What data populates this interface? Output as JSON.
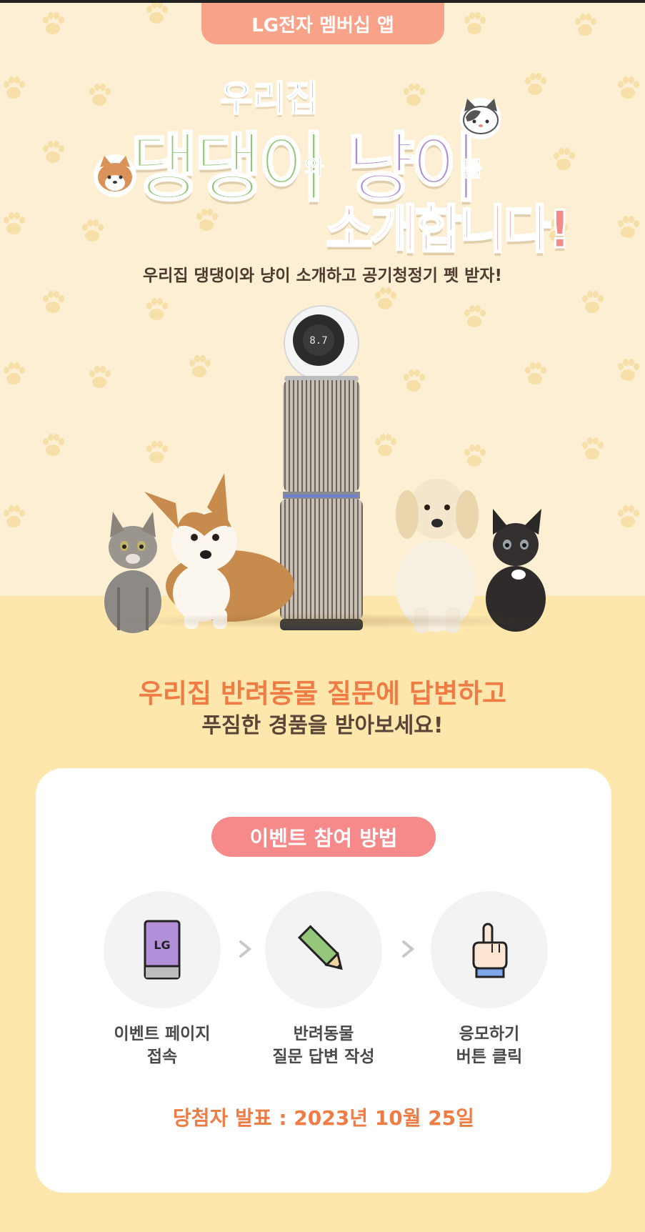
{
  "header": {
    "tab_label": "LG전자 멤버십 앱"
  },
  "hero": {
    "title_top": "우리집",
    "title_dog": "댕댕이",
    "title_wa": "와",
    "title_cat": "냥이",
    "title_reul": "를",
    "title_bottom": "소개합니다!",
    "subtitle": "우리집 댕댕이와 냥이 소개하고 공기청정기 펫 받자!",
    "product_display": "8.7"
  },
  "question": {
    "line1": "우리집 반려동물 질문에 답변하고",
    "line2": "푸짐한 경품을 받아보세요!"
  },
  "event": {
    "pill_label": "이벤트 참여 방법",
    "steps": [
      {
        "line1": "이벤트 페이지",
        "line2": "접속",
        "icon": "lg-phone-icon",
        "icon_text": "LG"
      },
      {
        "line1": "반려동물",
        "line2": "질문 답변 작성",
        "icon": "pencil-icon"
      },
      {
        "line1": "응모하기",
        "line2": "버튼 클릭",
        "icon": "pointing-hand-icon"
      }
    ],
    "winner_text": "당첨자 발표 : 2023년 10월 25일"
  },
  "colors": {
    "tab": "#f9a28a",
    "dog_text": "#93c678",
    "cat_text": "#ad8bd7",
    "intro_text": "#f38a8a",
    "accent_orange": "#ef7b45",
    "pill": "#f68a8a",
    "hero_bg": "#fdefd3",
    "floor_bg": "#fde7ad"
  }
}
